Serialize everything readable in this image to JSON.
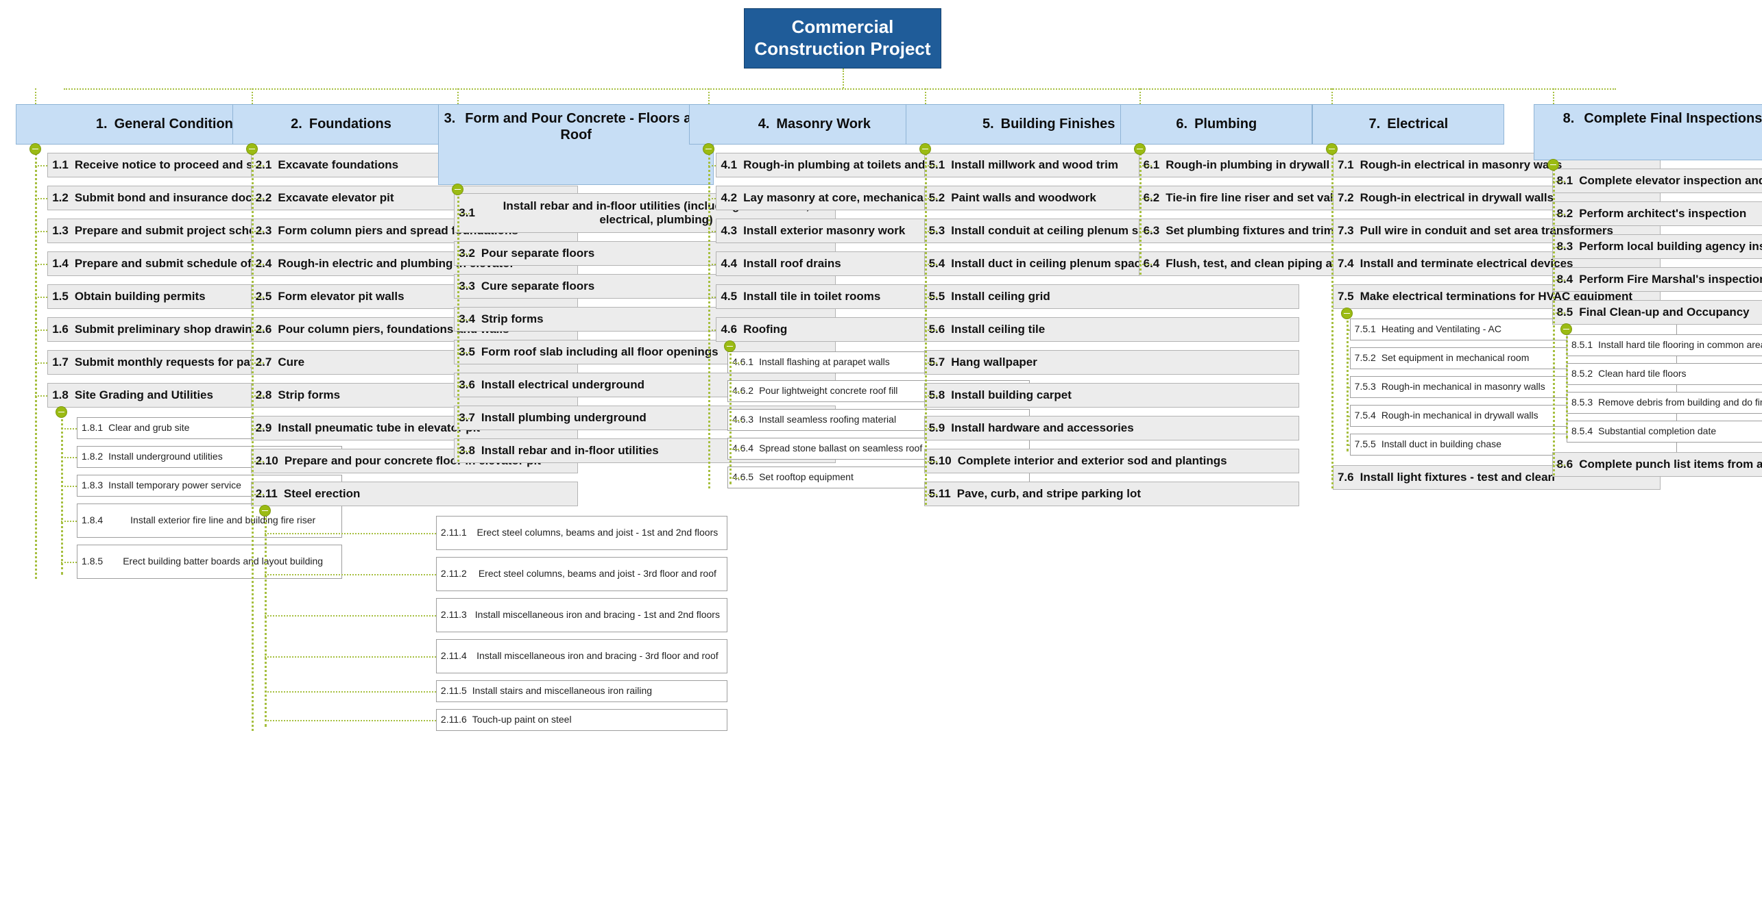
{
  "diagram": {
    "type": "work-breakdown-structure",
    "root": {
      "title": "Commercial\nConstruction Project",
      "line1": "Commercial",
      "line2": "Construction Project",
      "color": "#1F5C99",
      "text_color": "#FFFFFF"
    },
    "colors": {
      "level1_fill": "#C7DEF5",
      "level1_border": "#8FB4D6",
      "level2_fill": "#ECECEC",
      "level2_border": "#B4B4B4",
      "level3_fill": "#FFFFFF",
      "level3_border": "#9E9E9E",
      "connector": "#A6BF3F",
      "knob": "#9BBB13"
    },
    "columns": [
      {
        "num": "1.",
        "label": "General Conditions",
        "tasks": [
          {
            "num": "1.1",
            "text": "Receive notice to proceed and sign contract"
          },
          {
            "num": "1.2",
            "text": "Submit bond and insurance documents"
          },
          {
            "num": "1.3",
            "text": "Prepare and submit project schedule"
          },
          {
            "num": "1.4",
            "text": "Prepare and submit schedule of values"
          },
          {
            "num": "1.5",
            "text": "Obtain building permits"
          },
          {
            "num": "1.6",
            "text": "Submit preliminary shop drawings"
          },
          {
            "num": "1.7",
            "text": "Submit monthly requests for payment"
          },
          {
            "num": "1.8",
            "text": "Site Grading and Utilities",
            "subs": [
              {
                "num": "1.8.1",
                "text": "Clear and grub site"
              },
              {
                "num": "1.8.2",
                "text": "Install underground utilities"
              },
              {
                "num": "1.8.3",
                "text": "Install temporary power service"
              },
              {
                "num": "1.8.4",
                "text": "Install exterior fire line and building fire riser"
              },
              {
                "num": "1.8.5",
                "text": "Erect building batter boards and layout building"
              }
            ]
          }
        ]
      },
      {
        "num": "2.",
        "label": "Foundations",
        "tasks": [
          {
            "num": "2.1",
            "text": "Excavate foundations"
          },
          {
            "num": "2.2",
            "text": "Excavate elevator pit"
          },
          {
            "num": "2.3",
            "text": "Form column piers and spread foundations"
          },
          {
            "num": "2.4",
            "text": "Rough-in electric and plumbing in elevator"
          },
          {
            "num": "2.5",
            "text": "Form elevator pit walls"
          },
          {
            "num": "2.6",
            "text": "Pour column piers, foundations and walls"
          },
          {
            "num": "2.7",
            "text": "Cure"
          },
          {
            "num": "2.8",
            "text": "Strip forms"
          },
          {
            "num": "2.9",
            "text": "Install pneumatic tube in elevator pit"
          },
          {
            "num": "2.10",
            "text": "Prepare and pour concrete floor in elevator pit"
          },
          {
            "num": "2.11",
            "text": "Steel erection",
            "subs": [
              {
                "num": "2.11.1",
                "text": "Erect steel columns, beams and joist - 1st and 2nd floors"
              },
              {
                "num": "2.11.2",
                "text": "Erect steel columns, beams and joist - 3rd floor and roof"
              },
              {
                "num": "2.11.3",
                "text": "Install miscellaneous iron and bracing - 1st and 2nd floors"
              },
              {
                "num": "2.11.4",
                "text": "Install miscellaneous iron and bracing - 3rd floor and roof"
              },
              {
                "num": "2.11.5",
                "text": "Install stairs and miscellaneous iron railing"
              },
              {
                "num": "2.11.6",
                "text": "Touch-up paint on steel"
              }
            ]
          }
        ]
      },
      {
        "num": "3.",
        "label": "Form and Pour Concrete - Floors and Roof",
        "tasks": [
          {
            "num": "3.1",
            "text": "Install rebar and in-floor utilities (including mechanical, electrical, plumbing)"
          },
          {
            "num": "3.2",
            "text": "Pour separate floors"
          },
          {
            "num": "3.3",
            "text": "Cure separate floors"
          },
          {
            "num": "3.4",
            "text": "Strip forms"
          },
          {
            "num": "3.5",
            "text": "Form roof slab including all floor openings"
          },
          {
            "num": "3.6",
            "text": "Install electrical underground"
          },
          {
            "num": "3.7",
            "text": "Install plumbing underground"
          },
          {
            "num": "3.8",
            "text": "Install rebar and in-floor utilities"
          }
        ]
      },
      {
        "num": "4.",
        "label": "Masonry Work",
        "tasks": [
          {
            "num": "4.1",
            "text": "Rough-in plumbing at toilets and masonry walls"
          },
          {
            "num": "4.2",
            "text": "Lay masonry at core, mechanical, and toilets"
          },
          {
            "num": "4.3",
            "text": "Install exterior masonry work"
          },
          {
            "num": "4.4",
            "text": "Install roof drains"
          },
          {
            "num": "4.5",
            "text": "Install tile in toilet rooms"
          },
          {
            "num": "4.6",
            "text": "Roofing",
            "subs": [
              {
                "num": "4.6.1",
                "text": "Install flashing at parapet walls"
              },
              {
                "num": "4.6.2",
                "text": "Pour lightweight concrete roof fill"
              },
              {
                "num": "4.6.3",
                "text": "Install seamless roofing material"
              },
              {
                "num": "4.6.4",
                "text": "Spread stone ballast on seamless roof"
              },
              {
                "num": "4.6.5",
                "text": "Set rooftop equipment"
              }
            ]
          }
        ]
      },
      {
        "num": "5.",
        "label": "Building Finishes",
        "tasks": [
          {
            "num": "5.1",
            "text": "Install millwork and wood trim"
          },
          {
            "num": "5.2",
            "text": "Paint walls and woodwork"
          },
          {
            "num": "5.3",
            "text": "Install conduit at ceiling plenum space"
          },
          {
            "num": "5.4",
            "text": "Install duct in ceiling plenum space"
          },
          {
            "num": "5.5",
            "text": "Install ceiling grid"
          },
          {
            "num": "5.6",
            "text": "Install ceiling tile"
          },
          {
            "num": "5.7",
            "text": "Hang wallpaper"
          },
          {
            "num": "5.8",
            "text": "Install building carpet"
          },
          {
            "num": "5.9",
            "text": "Install hardware and accessories"
          },
          {
            "num": "5.10",
            "text": "Complete interior and exterior sod and plantings"
          },
          {
            "num": "5.11",
            "text": "Pave, curb, and stripe parking lot"
          }
        ]
      },
      {
        "num": "6.",
        "label": "Plumbing",
        "tasks": [
          {
            "num": "6.1",
            "text": "Rough-in plumbing in drywall walls"
          },
          {
            "num": "6.2",
            "text": "Tie-in fire line riser and set valves"
          },
          {
            "num": "6.3",
            "text": "Set plumbing fixtures and trim"
          },
          {
            "num": "6.4",
            "text": "Flush, test, and clean piping and fixtures"
          }
        ]
      },
      {
        "num": "7.",
        "label": "Electrical",
        "tasks": [
          {
            "num": "7.1",
            "text": "Rough-in electrical in masonry walls"
          },
          {
            "num": "7.2",
            "text": "Rough-in electrical in drywall walls"
          },
          {
            "num": "7.3",
            "text": "Pull wire in conduit and set area transformers"
          },
          {
            "num": "7.4",
            "text": "Install and terminate electrical devices"
          },
          {
            "num": "7.5",
            "text": "Make electrical terminations for HVAC equipment",
            "subs": [
              {
                "num": "7.5.1",
                "text": "Heating and Ventilating - AC"
              },
              {
                "num": "7.5.2",
                "text": "Set equipment in mechanical room"
              },
              {
                "num": "7.5.3",
                "text": "Rough-in mechanical in masonry walls"
              },
              {
                "num": "7.5.4",
                "text": "Rough-in mechanical in drywall walls"
              },
              {
                "num": "7.5.5",
                "text": "Install duct in building chase"
              }
            ]
          },
          {
            "num": "7.6",
            "text": "Install light fixtures - test and clean"
          }
        ]
      },
      {
        "num": "8.",
        "label": "Complete Final Inspections",
        "tasks": [
          {
            "num": "8.1",
            "text": "Complete elevator inspection and certification"
          },
          {
            "num": "8.2",
            "text": "Perform architect's inspection"
          },
          {
            "num": "8.3",
            "text": "Perform local building agency inspection"
          },
          {
            "num": "8.4",
            "text": "Perform Fire Marshal's inspection"
          },
          {
            "num": "8.5",
            "text": "Final Clean-up and Occupancy",
            "subs": [
              {
                "num": "8.5.1",
                "text": "Install hard tile flooring in common areas"
              },
              {
                "num": "8.5.2",
                "text": "Clean hard tile floors"
              },
              {
                "num": "8.5.3",
                "text": "Remove debris from building and do final clean-up"
              },
              {
                "num": "8.5.4",
                "text": "Substantial completion date"
              }
            ]
          },
          {
            "num": "8.6",
            "text": "Complete punch list items from all inspections"
          }
        ]
      }
    ]
  }
}
